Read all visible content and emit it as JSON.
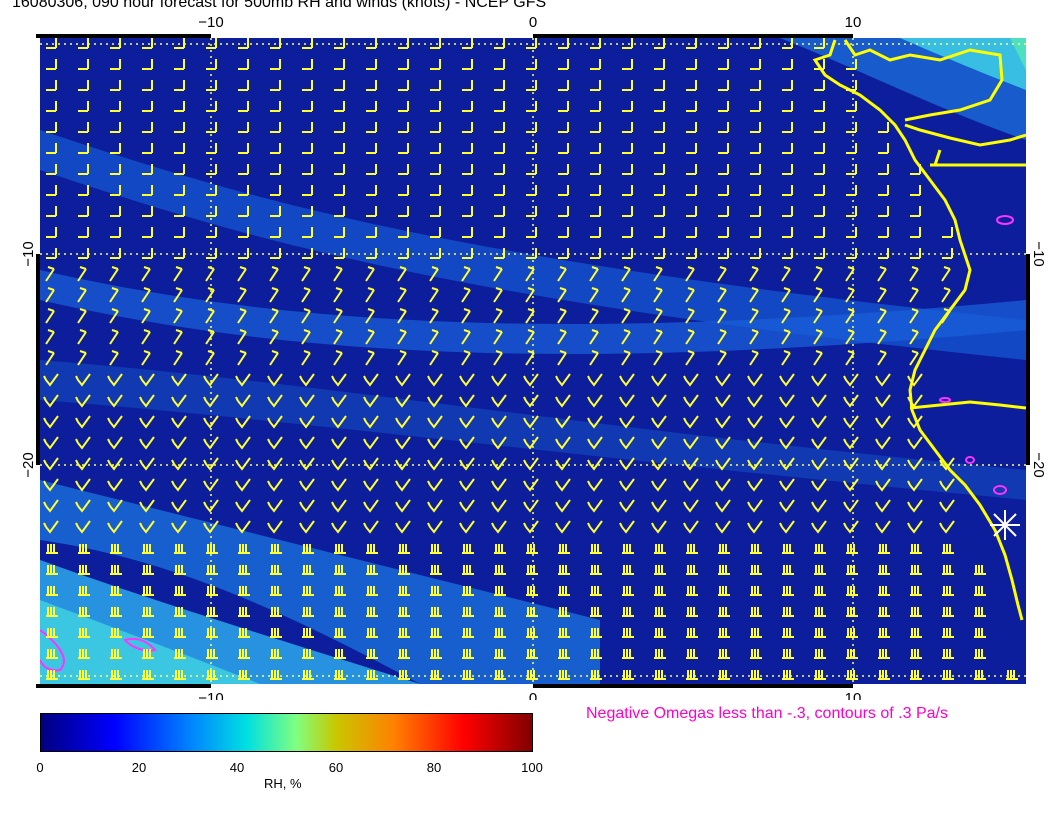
{
  "title": "16080306, 090 hour forecast for 500mb RH and winds (knots) - NCEP GFS",
  "map": {
    "lon_ticks": [
      "−10",
      "0",
      "10"
    ],
    "lat_ticks": [
      "−10",
      "−20"
    ],
    "coastline_color": "#ffff00",
    "barb_color": "#ffff33",
    "omega_contour_color": "#ff33ff",
    "gridline_color": "#ffff66",
    "station_marker": "star-cross-icon"
  },
  "annotation": {
    "text": "Negative Omegas less than -.3, contours of .3 Pa/s",
    "color": "#ff00cc"
  },
  "colorbar": {
    "tick_labels": [
      "0",
      "20",
      "40",
      "60",
      "80",
      "100"
    ],
    "label": "RH, %",
    "stops": [
      "#00007f",
      "#0000ff",
      "#0080ff",
      "#00e0e0",
      "#80ff80",
      "#c8c800",
      "#ff8000",
      "#ff0000",
      "#800000"
    ]
  }
}
